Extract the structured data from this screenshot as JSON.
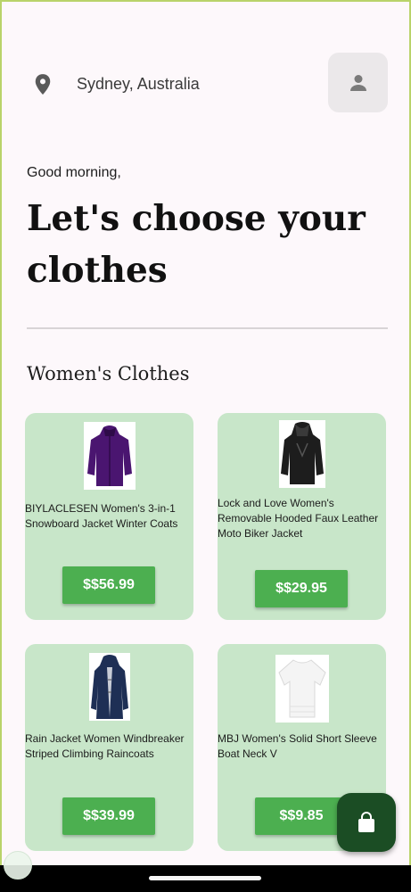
{
  "header": {
    "location": "Sydney, Australia",
    "location_icon": "location-pin-icon",
    "profile_icon": "person-icon"
  },
  "greeting": "Good morning,",
  "headline": "Let's choose your clothes",
  "section_title": "Women's Clothes",
  "products": [
    {
      "name": "BIYLACLESEN Women's 3-in-1 Snowboard Jacket Winter Coats",
      "price": "$$56.99",
      "image": "purple-jacket"
    },
    {
      "name": "Lock and Love Women's Removable Hooded Faux Leather Moto Biker Jacket",
      "price": "$$29.95",
      "image": "black-leather-jacket"
    },
    {
      "name": "Rain Jacket Women Windbreaker Striped Climbing Raincoats",
      "price": "$$39.99",
      "image": "navy-raincoat"
    },
    {
      "name": "MBJ Women's Solid Short Sleeve Boat Neck V",
      "price": "$$9.85",
      "image": "white-top"
    }
  ],
  "fab_icon": "shopping-bag-icon",
  "colors": {
    "card_bg": "#c8e6c9",
    "price_button": "#4caf50",
    "fab_bg": "#1b4d24",
    "page_bg": "#fdf8fb"
  }
}
